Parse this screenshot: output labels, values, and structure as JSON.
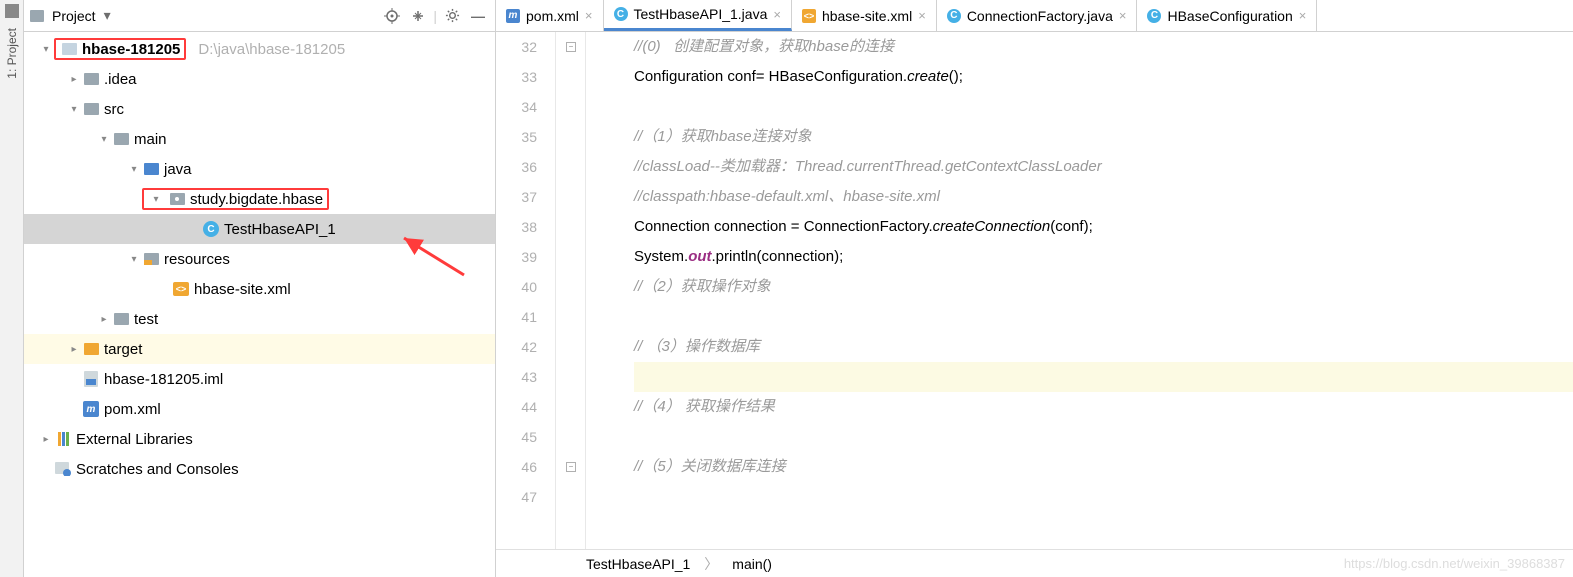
{
  "sideTab": {
    "label": "1: Project"
  },
  "panel": {
    "title": "Project",
    "dropdown": "▾"
  },
  "tree": {
    "root": {
      "label": "hbase-181205",
      "path": "D:\\java\\hbase-181205"
    },
    "idea": ".idea",
    "src": "src",
    "main": "main",
    "java": "java",
    "pkg": "study.bigdate.hbase",
    "testClass": "TestHbaseAPI_1",
    "resources": "resources",
    "siteXml": "hbase-site.xml",
    "test": "test",
    "target": "target",
    "iml": "hbase-181205.iml",
    "pom": "pom.xml",
    "extLib": "External Libraries",
    "scratch": "Scratches and Consoles"
  },
  "tabs": [
    {
      "icon": "m",
      "label": "pom.xml"
    },
    {
      "icon": "c",
      "label": "TestHbaseAPI_1.java",
      "active": true
    },
    {
      "icon": "x",
      "label": "hbase-site.xml"
    },
    {
      "icon": "c",
      "label": "ConnectionFactory.java"
    },
    {
      "icon": "c",
      "label": "HBaseConfiguration"
    }
  ],
  "code": {
    "startLine": 32,
    "lines": [
      {
        "t": "//(0)   创建配置对象，获取hbase的连接",
        "c": "cm"
      },
      {
        "segs": [
          {
            "t": "Configuration conf= HBaseConfiguration."
          },
          {
            "t": "create",
            "c": "it"
          },
          {
            "t": "();"
          }
        ]
      },
      {
        "t": ""
      },
      {
        "t": "//（1）获取hbase连接对象",
        "c": "cm"
      },
      {
        "t": "//classLoad--类加载器：Thread.currentThread.getContextClassLoader",
        "c": "cm"
      },
      {
        "t": "//classpath:hbase-default.xml、hbase-site.xml",
        "c": "cm"
      },
      {
        "segs": [
          {
            "t": "Connection connection = ConnectionFactory."
          },
          {
            "t": "createConnection",
            "c": "it"
          },
          {
            "t": "(conf);"
          }
        ]
      },
      {
        "segs": [
          {
            "t": "System."
          },
          {
            "t": "out",
            "c": "field"
          },
          {
            "t": ".println(connection);"
          }
        ]
      },
      {
        "t": "//（2）获取操作对象",
        "c": "cm"
      },
      {
        "t": ""
      },
      {
        "t": "// （3）操作数据库",
        "c": "cm"
      },
      {
        "t": "",
        "hl": true
      },
      {
        "t": "//（4） 获取操作结果",
        "c": "cm"
      },
      {
        "t": ""
      },
      {
        "t": "//（5）关闭数据库连接",
        "c": "cm"
      },
      {
        "t": ""
      }
    ]
  },
  "breadcrumb": {
    "a": "TestHbaseAPI_1",
    "b": "main()"
  },
  "watermark": "https://blog.csdn.net/weixin_39868387"
}
